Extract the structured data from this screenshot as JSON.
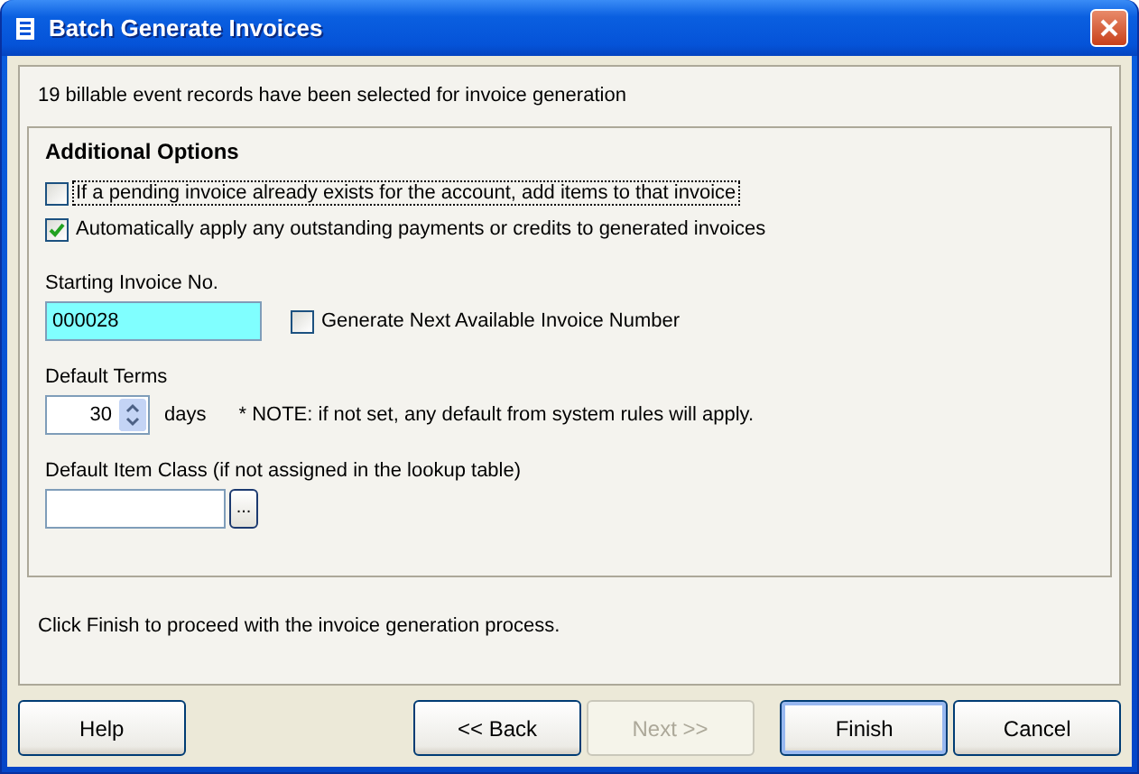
{
  "window": {
    "title": "Batch Generate Invoices"
  },
  "summary": "19 billable event records have been selected for invoice generation",
  "options": {
    "title": "Additional Options",
    "checkboxes": [
      {
        "label": "If a pending invoice already exists for the account, add items to that invoice",
        "checked": false,
        "focused": true
      },
      {
        "label": "Automatically apply any outstanding payments or credits to generated invoices",
        "checked": true,
        "focused": false
      }
    ],
    "starting_invoice": {
      "label": "Starting Invoice No.",
      "value": "000028"
    },
    "generate_next": {
      "label": "Generate Next Available Invoice Number",
      "checked": false
    },
    "default_terms": {
      "label": "Default Terms",
      "value": "30",
      "unit": "days",
      "note": "* NOTE: if not set, any default from system rules will apply."
    },
    "item_class": {
      "label": "Default Item Class (if not assigned in the lookup table)",
      "browse": "..."
    }
  },
  "footer": "Click Finish to proceed with the invoice generation process.",
  "buttons": [
    {
      "label": "Help",
      "disabled": false,
      "default": false
    },
    {
      "label": "<< Back",
      "disabled": false,
      "default": false
    },
    {
      "label": "Next >>",
      "disabled": true,
      "default": false
    },
    {
      "label": "Finish",
      "disabled": false,
      "default": true
    },
    {
      "label": "Cancel",
      "disabled": false,
      "default": false
    }
  ]
}
